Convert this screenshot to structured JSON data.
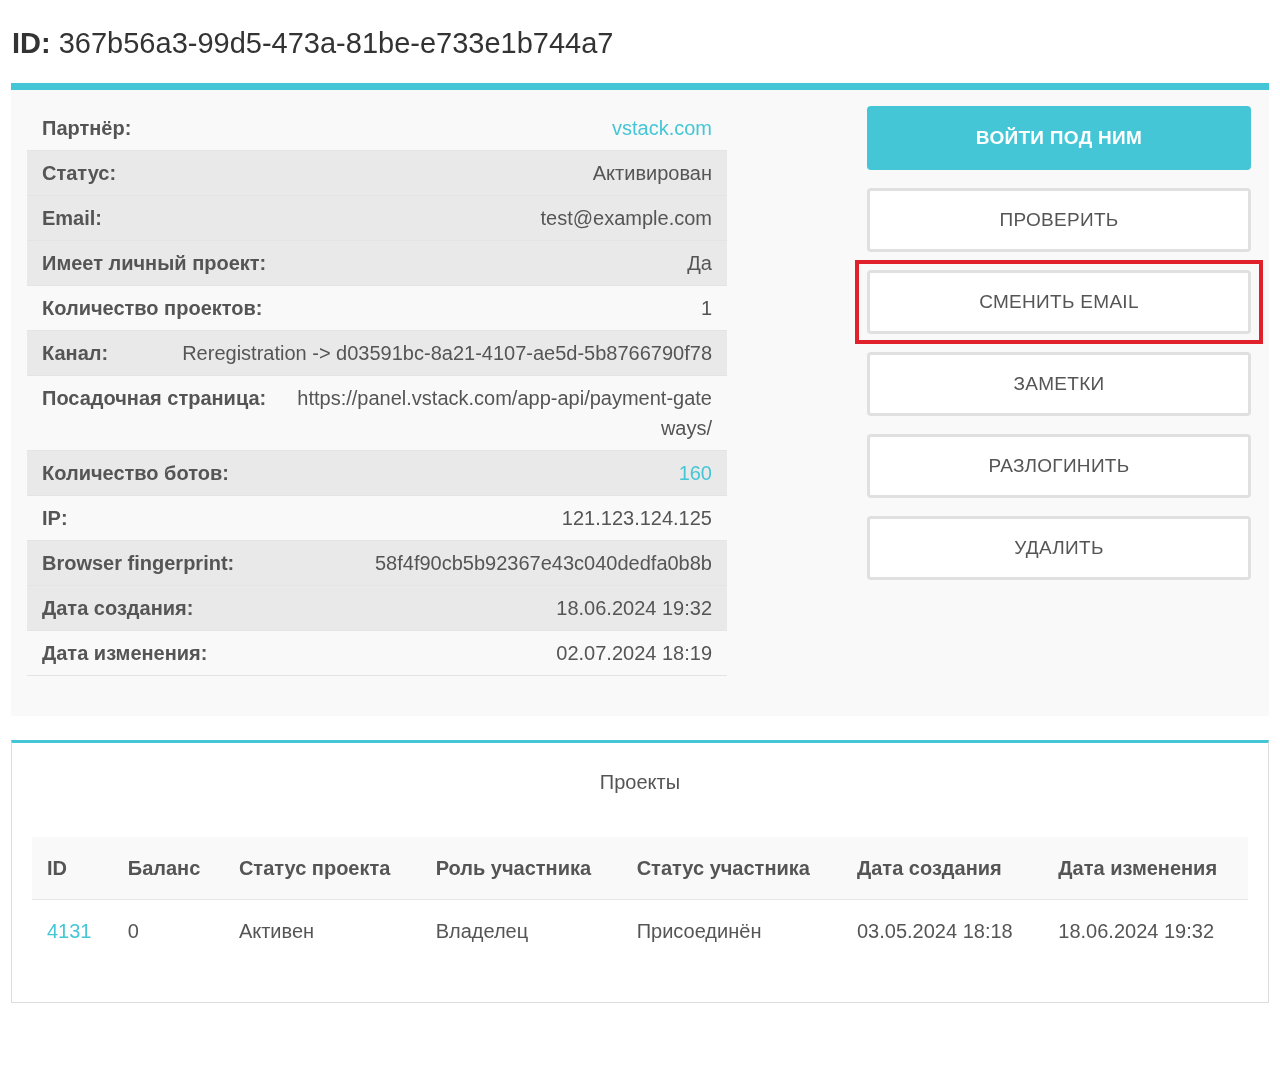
{
  "header": {
    "label": "ID:",
    "value": "367b56a3-99d5-473a-81be-e733e1b744a7"
  },
  "details": [
    {
      "label": "Партнёр:",
      "value": "vstack.com",
      "link": true,
      "shaded": false
    },
    {
      "label": "Статус:",
      "value": "Активирован",
      "link": false,
      "shaded": true
    },
    {
      "label": "Email:",
      "value": "test@example.com",
      "link": false,
      "shaded": true
    },
    {
      "label": "Имеет личный проект:",
      "value": "Да",
      "link": false,
      "shaded": true
    },
    {
      "label": "Количество проектов:",
      "value": "1",
      "link": false,
      "shaded": false
    },
    {
      "label": "Канал:",
      "value": "Reregistration -> d03591bc-8a21-4107-ae5d-5b8766790f78",
      "link": false,
      "shaded": true
    },
    {
      "label": "Посадочная страница:",
      "value": "https://panel.vstack.com/app-api/payment-gateways/",
      "link": false,
      "shaded": false
    },
    {
      "label": "Количество ботов:",
      "value": "160",
      "link": true,
      "shaded": true
    },
    {
      "label": "IP:",
      "value": "121.123.124.125",
      "link": false,
      "shaded": false
    },
    {
      "label": "Browser fingerprint:",
      "value": "58f4f90cb5b92367e43c040dedfa0b8b",
      "link": false,
      "shaded": true
    },
    {
      "label": "Дата создания:",
      "value": "18.06.2024 19:32",
      "link": false,
      "shaded": true
    },
    {
      "label": "Дата изменения:",
      "value": "02.07.2024 18:19",
      "link": false,
      "shaded": false
    }
  ],
  "actions": [
    {
      "label": "ВОЙТИ ПОД НИМ",
      "kind": "primary",
      "highlighted": false
    },
    {
      "label": "ПРОВЕРИТЬ",
      "kind": "outline",
      "highlighted": false
    },
    {
      "label": "СМЕНИТЬ EMAIL",
      "kind": "outline",
      "highlighted": true
    },
    {
      "label": "ЗАМЕТКИ",
      "kind": "outline",
      "highlighted": false
    },
    {
      "label": "РАЗЛОГИНИТЬ",
      "kind": "outline",
      "highlighted": false
    },
    {
      "label": "УДАЛИТЬ",
      "kind": "outline",
      "highlighted": false
    }
  ],
  "projects": {
    "title": "Проекты",
    "columns": [
      "ID",
      "Баланс",
      "Статус проекта",
      "Роль участника",
      "Статус участника",
      "Дата создания",
      "Дата изменения"
    ],
    "rows": [
      {
        "cells": [
          "4131",
          "0",
          "Активен",
          "Владелец",
          "Присоединён",
          "03.05.2024 18:18",
          "18.06.2024 19:32"
        ],
        "link_first": true
      }
    ]
  }
}
